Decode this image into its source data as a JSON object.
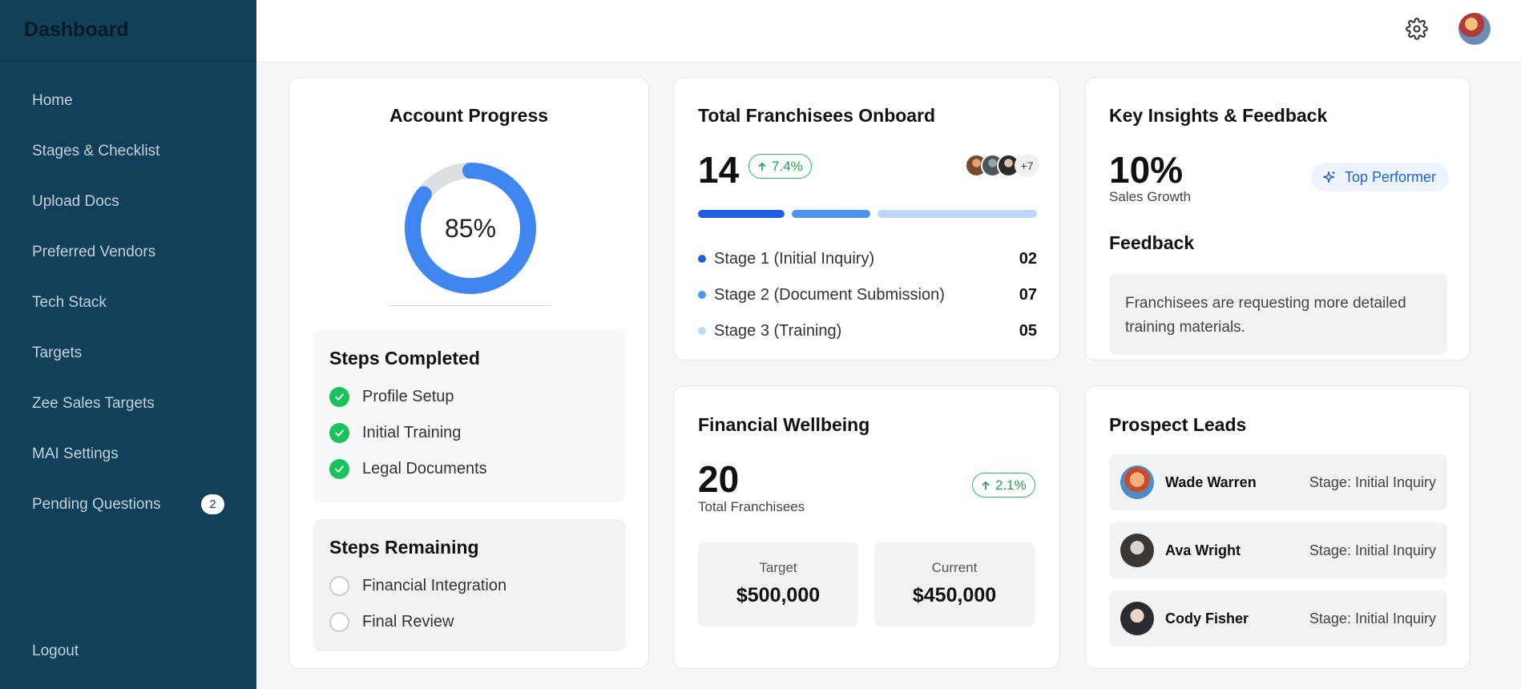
{
  "sidebar": {
    "title": "Dashboard",
    "items": [
      {
        "label": "Home"
      },
      {
        "label": "Stages & Checklist"
      },
      {
        "label": "Upload Docs"
      },
      {
        "label": "Preferred Vendors"
      },
      {
        "label": "Tech Stack"
      },
      {
        "label": "Targets"
      },
      {
        "label": "Zee Sales Targets"
      },
      {
        "label": "MAI Settings"
      },
      {
        "label": "Pending Questions",
        "badge": "2"
      }
    ],
    "logout": "Logout",
    "bg_color": "#12405a"
  },
  "topbar": {
    "settings_icon": "gear-icon",
    "avatar_icon": "user-avatar"
  },
  "account_progress": {
    "title": "Account Progress",
    "percent_label": "85%",
    "percent": 85,
    "steps_completed_title": "Steps Completed",
    "steps_completed": [
      "Profile Setup",
      "Initial Training",
      "Legal Documents"
    ],
    "steps_remaining_title": "Steps Remaining",
    "steps_remaining": [
      "Financial Integration",
      "Final Review"
    ]
  },
  "franchisees": {
    "title": "Total Franchisees Onboard",
    "count": "14",
    "change": "7.4%",
    "more_avatars": "+7",
    "stages": [
      {
        "label": "Stage 1 (Initial Inquiry)",
        "value": "02",
        "color": "#1d5fe0"
      },
      {
        "label": "Stage 2 (Document Submission)",
        "value": "07",
        "color": "#4c95ea"
      },
      {
        "label": "Stage 3 (Training)",
        "value": "05",
        "color": "#bcd7f6"
      }
    ]
  },
  "insights": {
    "title": "Key Insights & Feedback",
    "value": "10%",
    "value_label": "Sales Growth",
    "badge": "Top Performer",
    "feedback_title": "Feedback",
    "feedback_text": "Franchisees are requesting more detailed training materials."
  },
  "financial": {
    "title": "Financial Wellbeing",
    "count": "20",
    "count_label": "Total Franchisees",
    "change": "2.1%",
    "target_label": "Target",
    "target_value": "$500,000",
    "current_label": "Current",
    "current_value": "$450,000"
  },
  "leads": {
    "title": "Prospect Leads",
    "items": [
      {
        "name": "Wade Warren",
        "stage": "Stage: Initial Inquiry"
      },
      {
        "name": "Ava Wright",
        "stage": "Stage: Initial Inquiry"
      },
      {
        "name": "Cody Fisher",
        "stage": "Stage: Initial Inquiry"
      }
    ]
  },
  "colors": {
    "accent": "#3f86f0",
    "success": "#19c25a",
    "primary_blue": "#1d5fe0"
  }
}
